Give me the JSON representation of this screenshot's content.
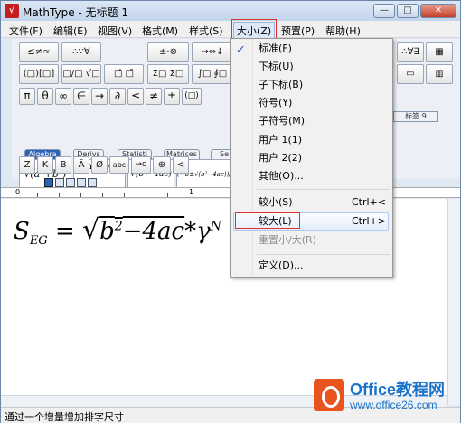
{
  "window": {
    "title": "MathType - 无标题 1",
    "minimize": "—",
    "maximize": "□",
    "close": "✕"
  },
  "menubar": {
    "items": [
      "文件(F)",
      "编辑(E)",
      "视图(V)",
      "格式(M)",
      "样式(S)",
      "大小(Z)",
      "预置(P)",
      "帮助(H)"
    ]
  },
  "toolbar": {
    "row1": [
      "≤≠≈",
      "∴∵∀",
      "±·⊗",
      "→⇔↓",
      "∴∀∃"
    ],
    "row2": [
      "(□)[□]",
      "□/□ √□",
      "□̂ □̄",
      "Σ□ Σ□",
      "∫□ ∮□"
    ],
    "row3": [
      "π",
      "θ",
      "∞",
      "∈",
      "→",
      "∂",
      "≤",
      "≠",
      "±",
      "(□)"
    ],
    "tabs": [
      "Algebra",
      "Derivs",
      "Statisti",
      "Matrices",
      "Se"
    ],
    "tab_right": "标签 9",
    "templates": [
      "√(a²+b²)",
      "lim x→∞",
      "√(b²−4ac)",
      "(−b±√(b²−4ac))/2a"
    ],
    "row5": [
      "Z",
      "K",
      "B",
      "Ā",
      "Ø",
      "abc",
      "→o",
      "⊕",
      "⊲"
    ]
  },
  "ruler": {
    "zero": "0",
    "one": "1"
  },
  "equation": {
    "lhs": "S",
    "lhs_sub": "EG",
    "equals": "=",
    "radicand_b": "b",
    "radicand_exp": "2",
    "radicand_rest": "−4ac",
    "rest": "*γ",
    "sup": "N"
  },
  "size_menu": {
    "items": [
      {
        "label": "标准(F)",
        "checked": true
      },
      {
        "label": "下标(U)"
      },
      {
        "label": "子下标(B)"
      },
      {
        "label": "符号(Y)"
      },
      {
        "label": "子符号(M)"
      },
      {
        "label": "用户 1(1)"
      },
      {
        "label": "用户 2(2)"
      },
      {
        "label": "其他(O)..."
      }
    ],
    "smaller": {
      "label": "较小(S)",
      "shortcut": "Ctrl+<"
    },
    "larger": {
      "label": "较大(L)",
      "shortcut": "Ctrl+>"
    },
    "reset": {
      "label": "重置小/大(R)"
    },
    "define": {
      "label": "定义(D)..."
    }
  },
  "status": {
    "text": "通过一个增量增加排字尺寸"
  },
  "watermark": {
    "brand": "Office教程网",
    "url": "www.office26.com"
  },
  "colors": {
    "highlight_red": "#e0322d",
    "menu_hover": "#e4eefb",
    "brand_orange": "#e8541e",
    "brand_blue": "#1a73c9"
  }
}
